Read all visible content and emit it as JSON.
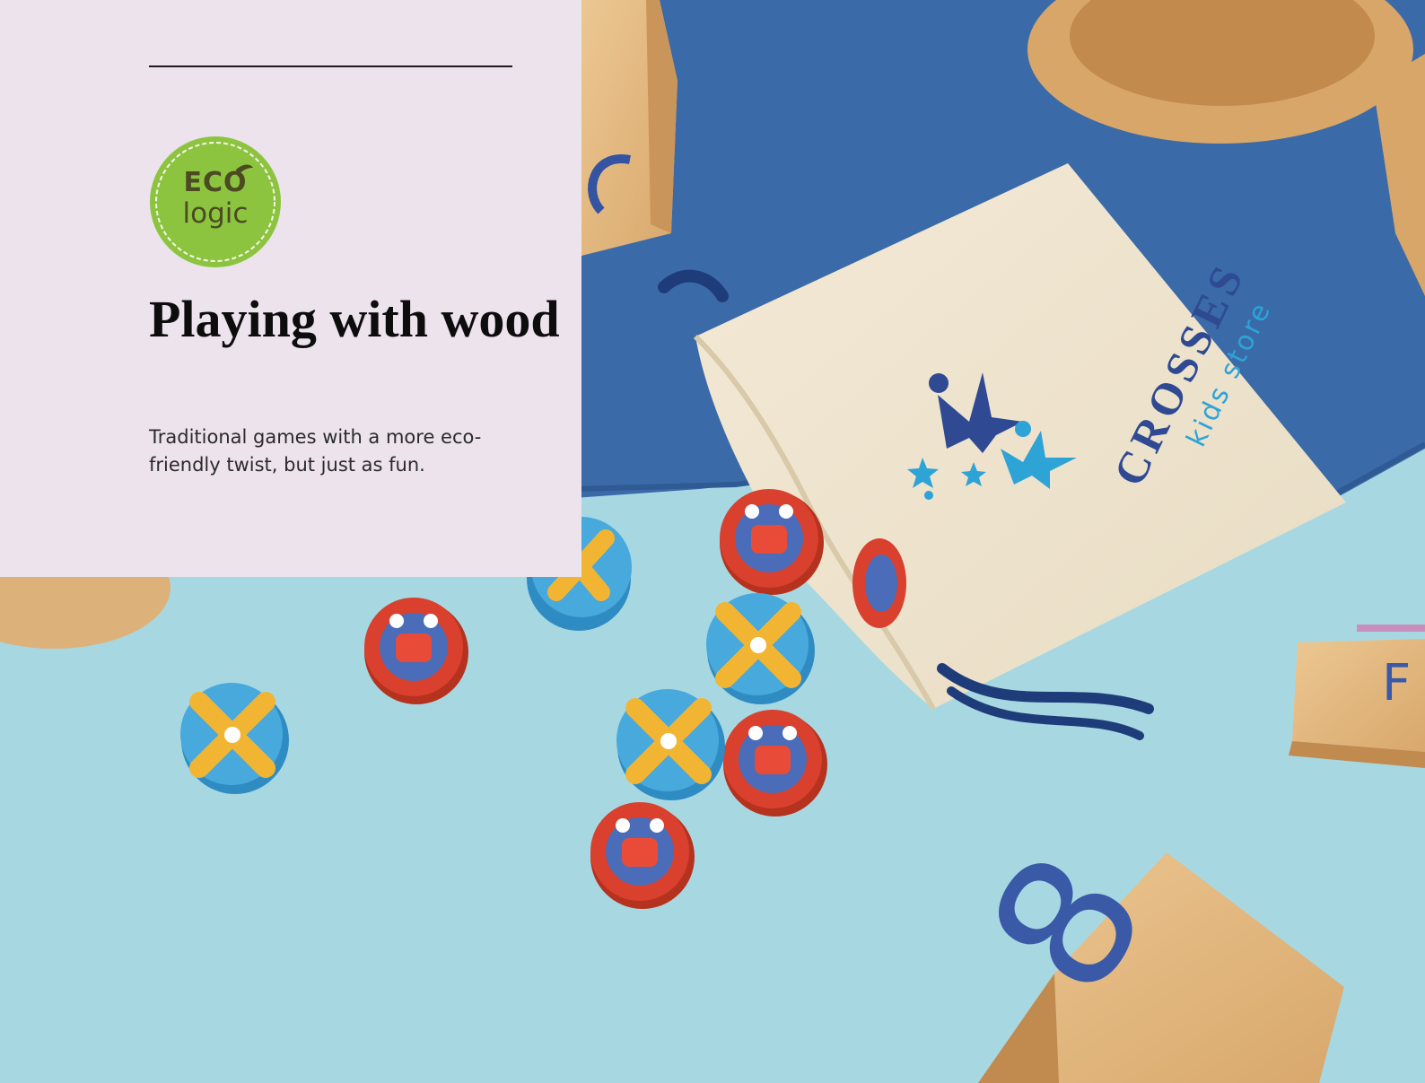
{
  "colors": {
    "panel_bg": "#ece3ec",
    "eco_green": "#8dc43f",
    "accent_pink": "#c88fbe",
    "felt_blue": "#3a6aa8",
    "table_blue": "#a7d8e2"
  },
  "badge": {
    "eco": "ECO",
    "logic": "logic"
  },
  "header": {
    "title": "Playing with wood",
    "subtitle": "Traditional games with a more eco-friendly twist, but just as fun."
  },
  "photo": {
    "bag_brand": "CROSSES",
    "bag_tagline": "kids store",
    "block_letter_f": "F",
    "block_number": "8"
  }
}
